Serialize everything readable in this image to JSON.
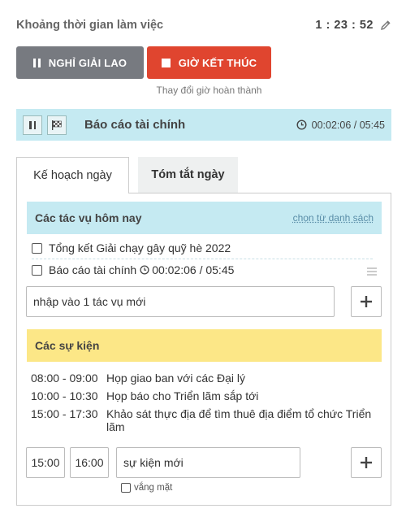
{
  "header": {
    "title": "Khoảng thời gian làm việc",
    "timer": "1 : 23 : 52"
  },
  "actions": {
    "break_label": "NGHỈ GIẢI LAO",
    "end_label": "GIỜ KẾT THÚC",
    "change_end_label": "Thay đổi giờ hoàn thành"
  },
  "current_task": {
    "title": "Báo cáo tài chính",
    "time": "00:02:06 / 05:45"
  },
  "tabs": [
    {
      "label": "Kế hoạch ngày",
      "active": true
    },
    {
      "label": "Tóm tắt ngày",
      "active": false
    }
  ],
  "tasks_section": {
    "title": "Các tác vụ hôm nay",
    "choose_link": "chọn từ danh sách",
    "items": [
      {
        "label": "Tổng kết Giải chạy gây quỹ hè 2022",
        "checked": false,
        "time": ""
      },
      {
        "label": "Báo cáo tài chính",
        "checked": false,
        "time": "00:02:06 / 05:45"
      }
    ],
    "new_task_placeholder": "nhập vào 1 tác vụ mới"
  },
  "events_section": {
    "title": "Các sự kiện",
    "items": [
      {
        "time": "08:00 - 09:00",
        "desc": "Họp giao ban với các Đại lý"
      },
      {
        "time": "10:00 - 10:30",
        "desc": "Họp báo cho Triển lãm sắp tới"
      },
      {
        "time": "15:00 - 17:30",
        "desc": "Khảo sát thực địa để tìm thuê địa điểm tổ chức Triển lãm"
      }
    ],
    "new_event_start": "15:00",
    "new_event_end": "16:00",
    "new_event_placeholder": "sự kiện mới",
    "absent_label": "vắng mặt"
  },
  "colors": {
    "break_button": "#777a80",
    "end_button": "#e0452f",
    "task_header_bg": "#c5eaf2",
    "event_header_bg": "#fce787"
  }
}
